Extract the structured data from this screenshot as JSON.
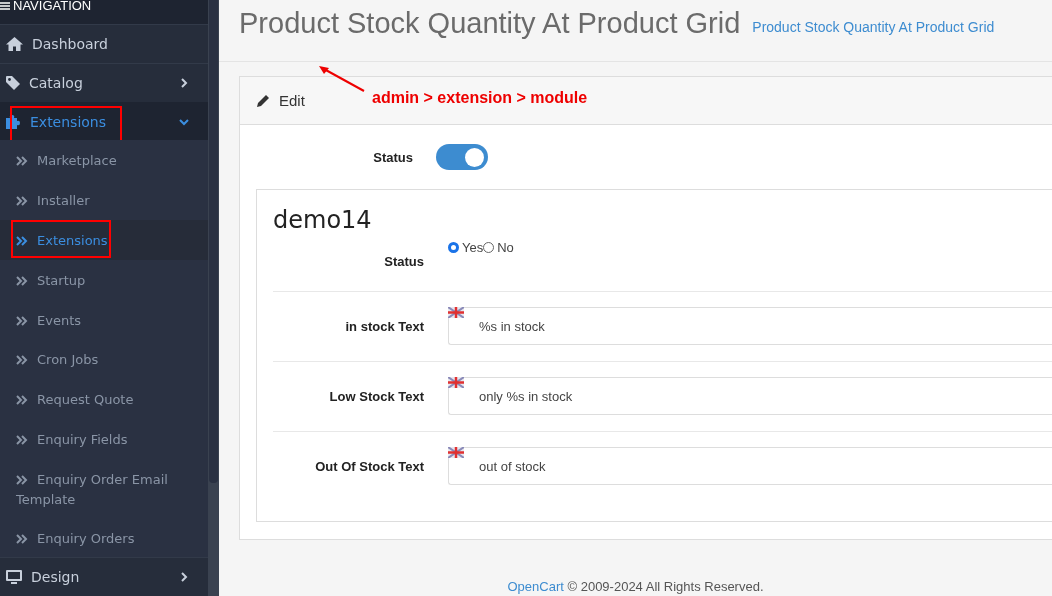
{
  "sidebar": {
    "header": "NAVIGATION",
    "items": [
      {
        "label": "Dashboard",
        "kind": "link",
        "selected": false,
        "annotated": false
      },
      {
        "label": "Catalog",
        "kind": "menu",
        "expanded": false,
        "selected": false,
        "annotated": false
      },
      {
        "label": "Extensions",
        "kind": "menu",
        "expanded": true,
        "selected": true,
        "annotated": true,
        "children": [
          {
            "label": "Marketplace",
            "selected": false,
            "annotated": false
          },
          {
            "label": "Installer",
            "selected": false,
            "annotated": false
          },
          {
            "label": "Extensions",
            "selected": true,
            "annotated": true
          },
          {
            "label": "Startup",
            "selected": false,
            "annotated": false
          },
          {
            "label": "Events",
            "selected": false,
            "annotated": false
          },
          {
            "label": "Cron Jobs",
            "selected": false,
            "annotated": false
          },
          {
            "label": "Request Quote",
            "selected": false,
            "annotated": false
          },
          {
            "label": "Enquiry Fields",
            "selected": false,
            "annotated": false
          },
          {
            "label": "Enquiry Order Email Template",
            "selected": false,
            "annotated": false
          },
          {
            "label": "Enquiry Orders",
            "selected": false,
            "annotated": false
          }
        ]
      },
      {
        "label": "Design",
        "kind": "menu",
        "expanded": false,
        "selected": false,
        "annotated": false
      }
    ]
  },
  "page": {
    "title": "Product Stock Quantity At Product Grid",
    "breadcrumb": "Product Stock Quantity At Product Grid"
  },
  "annotation": {
    "text": "admin > extension > module"
  },
  "panel": {
    "heading": "Edit",
    "status": {
      "label": "Status",
      "on": true
    },
    "module": {
      "name": "demo14",
      "status": {
        "label": "Status",
        "options": [
          {
            "label": "Yes",
            "selected": true
          },
          {
            "label": "No",
            "selected": false
          }
        ]
      },
      "fields": [
        {
          "label": "in stock Text",
          "value": "%s in stock"
        },
        {
          "label": "Low Stock Text",
          "value": "only %s in stock"
        },
        {
          "label": "Out Of Stock Text",
          "value": "out of stock"
        }
      ]
    }
  },
  "footer": {
    "link": "OpenCart",
    "text": "© 2009-2024 All Rights Reserved."
  }
}
